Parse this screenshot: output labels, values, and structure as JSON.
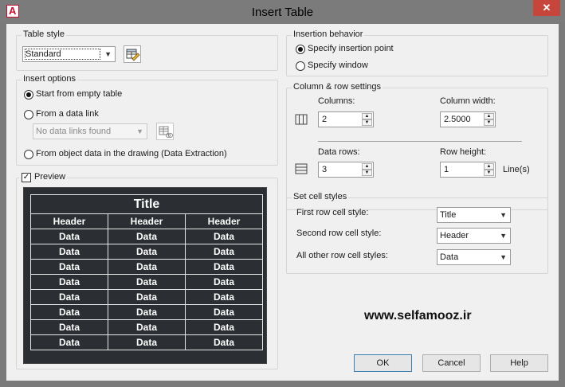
{
  "window": {
    "title": "Insert Table",
    "close_glyph": "✕",
    "app_icon_letter": "A"
  },
  "table_style": {
    "group_label": "Table style",
    "selected": "Standard",
    "edit_icon": "table-style-edit-icon"
  },
  "insert_options": {
    "group_label": "Insert options",
    "start_empty": "Start from empty table",
    "from_data_link": "From a data link",
    "data_link_select": "No data links found",
    "from_object_data": "From object data in the drawing (Data Extraction)",
    "selected": "start_empty"
  },
  "preview": {
    "label": "Preview",
    "checked": true,
    "table": {
      "title": "Title",
      "headers": [
        "Header",
        "Header",
        "Header"
      ],
      "rows": [
        [
          "Data",
          "Data",
          "Data"
        ],
        [
          "Data",
          "Data",
          "Data"
        ],
        [
          "Data",
          "Data",
          "Data"
        ],
        [
          "Data",
          "Data",
          "Data"
        ],
        [
          "Data",
          "Data",
          "Data"
        ],
        [
          "Data",
          "Data",
          "Data"
        ],
        [
          "Data",
          "Data",
          "Data"
        ],
        [
          "Data",
          "Data",
          "Data"
        ]
      ]
    }
  },
  "insertion_behavior": {
    "group_label": "Insertion behavior",
    "specify_point": "Specify insertion point",
    "specify_window": "Specify window",
    "selected": "specify_point"
  },
  "column_row": {
    "group_label": "Column & row settings",
    "columns_label": "Columns:",
    "columns_value": "2",
    "column_width_label": "Column width:",
    "column_width_value": "2.5000",
    "data_rows_label": "Data rows:",
    "data_rows_value": "3",
    "row_height_label": "Row height:",
    "row_height_value": "1",
    "row_height_unit": "Line(s)"
  },
  "cell_styles": {
    "group_label": "Set cell styles",
    "first_row_label": "First row cell style:",
    "first_row_value": "Title",
    "second_row_label": "Second row cell style:",
    "second_row_value": "Header",
    "other_rows_label": "All other row cell styles:",
    "other_rows_value": "Data"
  },
  "watermark": "www.selfamooz.ir",
  "buttons": {
    "ok": "OK",
    "cancel": "Cancel",
    "help": "Help"
  }
}
